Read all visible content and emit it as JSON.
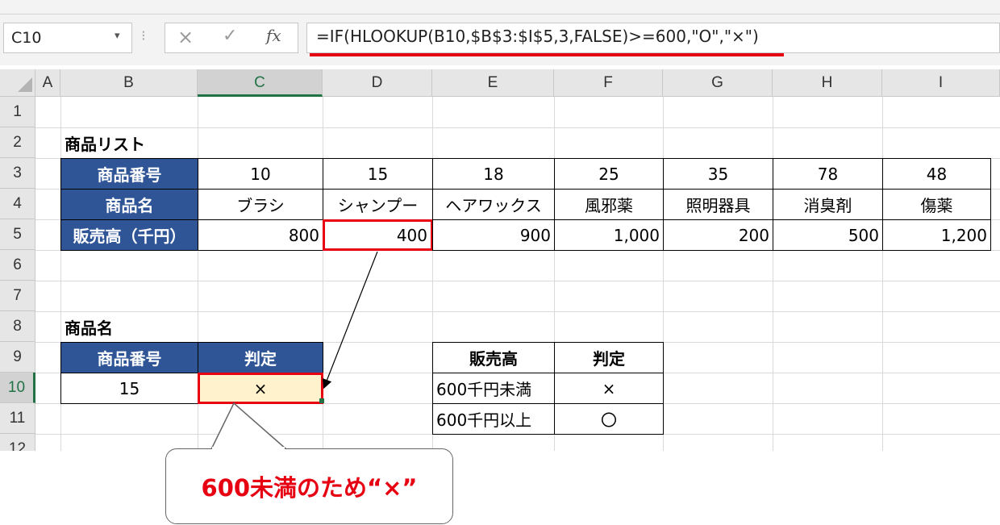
{
  "formula_bar": {
    "cell_ref": "C10",
    "formula": "=IF(HLOOKUP(B10,$B$3:$I$5,3,FALSE)>=600,\"O\",\"×\")",
    "cancel_icon": "×",
    "enter_icon": "✓",
    "fx_label": "fx",
    "caret": "▾",
    "dots": "⁝"
  },
  "columns": [
    "A",
    "B",
    "C",
    "D",
    "E",
    "F",
    "G",
    "H",
    "I"
  ],
  "rows": [
    "1",
    "2",
    "3",
    "4",
    "5",
    "6",
    "7",
    "8",
    "9",
    "10",
    "11",
    "12"
  ],
  "sections": {
    "product_list_title": "商品リスト",
    "product_name_title": "商品名"
  },
  "product_table": {
    "row_headers": [
      "商品番号",
      "商品名",
      "販売高（千円）"
    ],
    "numbers": [
      "10",
      "15",
      "18",
      "25",
      "35",
      "78",
      "48"
    ],
    "names": [
      "ブラシ",
      "シャンプー",
      "ヘアワックス",
      "風邪薬",
      "照明器具",
      "消臭剤",
      "傷薬"
    ],
    "sales": [
      "800",
      "400",
      "900",
      "1,000",
      "200",
      "500",
      "1,200"
    ]
  },
  "lookup_table": {
    "headers": [
      "商品番号",
      "判定"
    ],
    "number": "15",
    "result": "×"
  },
  "criteria_table": {
    "headers": [
      "販売高",
      "判定"
    ],
    "rows": [
      {
        "label": "600千円未満",
        "mark": "×"
      },
      {
        "label": "600千円以上",
        "mark": "〇"
      }
    ]
  },
  "callout": {
    "text": "600未満のため“×”"
  },
  "colors": {
    "header_fill": "#2f5597",
    "highlight": "#e60012",
    "result_fill": "#fff2cc",
    "excel_green": "#217346"
  }
}
